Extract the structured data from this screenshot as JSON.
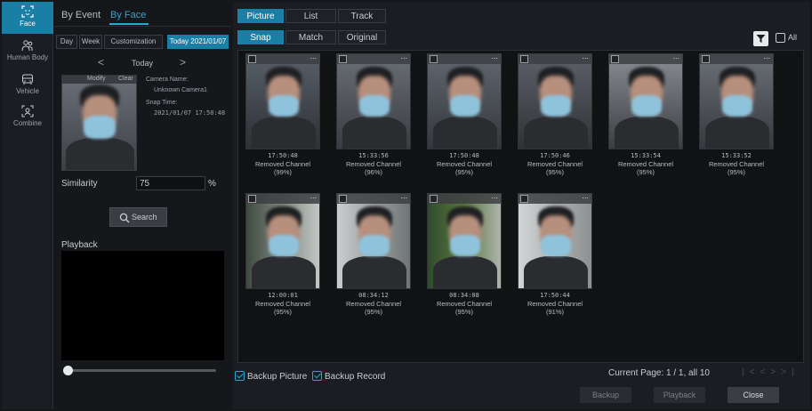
{
  "rail": [
    {
      "label": "Face",
      "icon": "face-icon",
      "active": true
    },
    {
      "label": "Human Body",
      "icon": "human-body-icon"
    },
    {
      "label": "Vehicle",
      "icon": "vehicle-icon"
    },
    {
      "label": "Combine",
      "icon": "combine-icon"
    }
  ],
  "search": {
    "tab_by_event": "By Event",
    "tab_by_face": "By Face",
    "range_day": "Day",
    "range_week": "Week",
    "range_custom": "Customization",
    "range_today": "Today 2021/01/07",
    "nav_prev": "<",
    "nav_label": "Today",
    "nav_next": ">",
    "modify": "Modify",
    "clear": "Clear",
    "camera_name_label": "Camera Name:",
    "camera_name_value": "Unknown Camera1",
    "snap_time_label": "Snap Time:",
    "snap_time_value": "2021/01/07 17:50:48",
    "similarity_label": "Similarity",
    "similarity_value": "75",
    "similarity_unit": "%",
    "search_button": "Search",
    "playback_label": "Playback"
  },
  "view_tabs": [
    "Picture",
    "List",
    "Track"
  ],
  "sub_tabs": [
    "Snap",
    "Match",
    "Original"
  ],
  "all_label": "All",
  "results": [
    {
      "time": "17:50:48",
      "channel": "Removed Channel",
      "score": "(99%)"
    },
    {
      "time": "15:33:56",
      "channel": "Removed Channel",
      "score": "(96%)"
    },
    {
      "time": "17:50:48",
      "channel": "Removed Channel",
      "score": "(95%)"
    },
    {
      "time": "17:50:46",
      "channel": "Removed Channel",
      "score": "(95%)"
    },
    {
      "time": "15:33:54",
      "channel": "Removed Channel",
      "score": "(95%)"
    },
    {
      "time": "15:33:52",
      "channel": "Removed Channel",
      "score": "(95%)"
    },
    {
      "time": "12:00:01",
      "channel": "Removed Channel",
      "score": "(95%)"
    },
    {
      "time": "08:34:12",
      "channel": "Removed Channel",
      "score": "(95%)"
    },
    {
      "time": "08:34:08",
      "channel": "Removed Channel",
      "score": "(95%)"
    },
    {
      "time": "17:50:44",
      "channel": "Removed Channel",
      "score": "(91%)"
    }
  ],
  "card_menu": "...",
  "footer": {
    "backup_picture": "Backup Picture",
    "backup_record": "Backup Record",
    "page_info": "Current Page: 1 / 1, all 10",
    "backup_button": "Backup",
    "playback_button": "Playback",
    "close_button": "Close"
  },
  "colors": {
    "accent": "#1a7fa5",
    "highlight": "#2aa6d6",
    "background": "#15171b"
  }
}
